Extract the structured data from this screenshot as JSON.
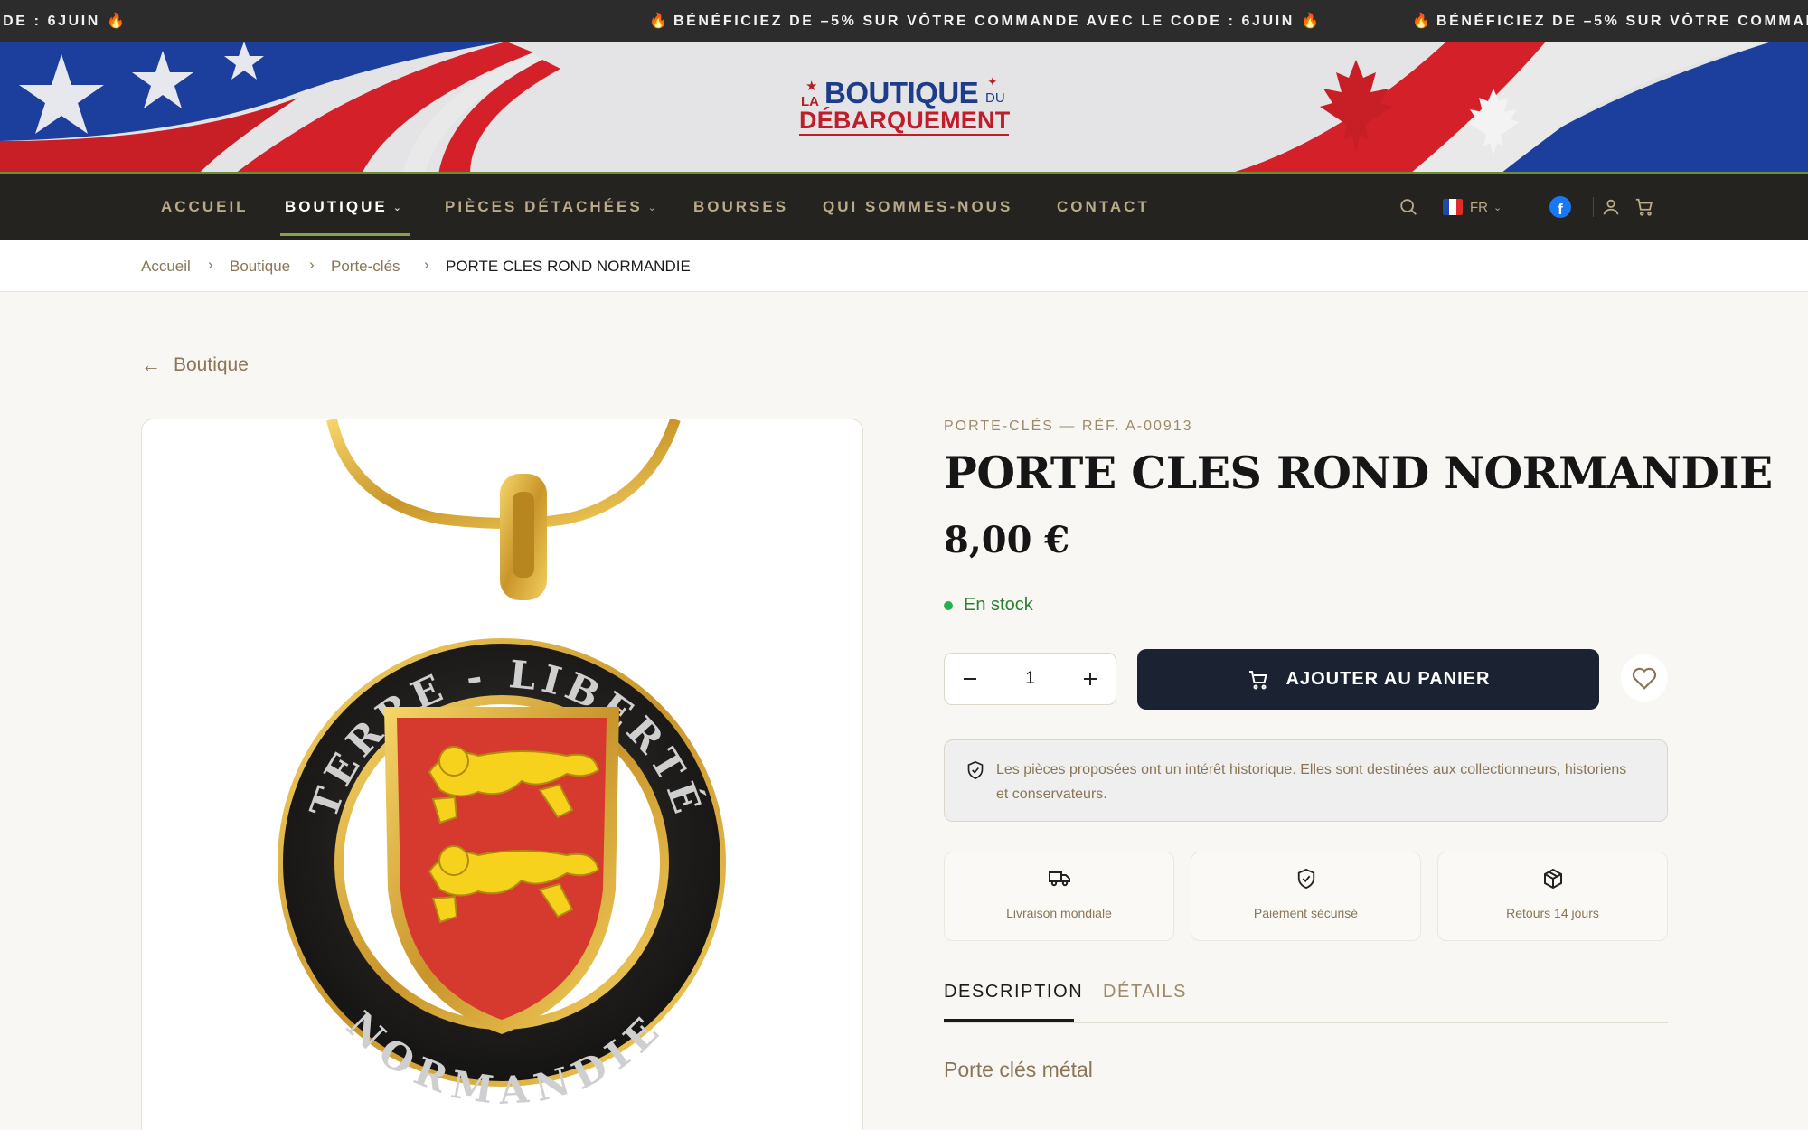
{
  "promo": {
    "message": "BÉNÉFICIEZ DE –5% SUR VÔTRE COMMANDE AVEC LE CODE : 6JUIN",
    "flame": "🔥"
  },
  "logo": {
    "la": "LA",
    "boutique": "BOUTIQUE",
    "du": "DU",
    "debarquement": "DÉBARQUEMENT"
  },
  "nav": {
    "items": [
      {
        "label": "ACCUEIL"
      },
      {
        "label": "BOUTIQUE",
        "active": true,
        "dropdown": true
      },
      {
        "label": "PIÈCES DÉTACHÉES",
        "dropdown": true
      },
      {
        "label": "BOURSES"
      },
      {
        "label": "QUI SOMMES-NOUS"
      },
      {
        "label": "CONTACT"
      }
    ],
    "language": "FR",
    "icons": [
      "search-icon",
      "flag-fr-icon",
      "facebook-icon",
      "account-icon",
      "cart-icon"
    ]
  },
  "breadcrumb": {
    "items": [
      "Accueil",
      "Boutique",
      "Porte-clés"
    ],
    "current": "PORTE CLES ROND NORMANDIE"
  },
  "back": {
    "label": "Boutique"
  },
  "product": {
    "category_ref": "PORTE-CLÉS — RÉF. A-00913",
    "title": "PORTE CLES ROND NORMANDIE",
    "price": "8,00 €",
    "stock": "En stock",
    "quantity": "1",
    "add_to_cart": "AJOUTER AU PANIER",
    "notice": "Les pièces proposées ont un intérêt historique. Elles sont destinées aux collectionneurs, historiens et conservateurs.",
    "features": [
      {
        "label": "Livraison mondiale",
        "icon": "truck-icon"
      },
      {
        "label": "Paiement sécurisé",
        "icon": "shield-check-icon"
      },
      {
        "label": "Retours 14 jours",
        "icon": "package-icon"
      }
    ],
    "tabs": [
      {
        "label": "DESCRIPTION",
        "active": true
      },
      {
        "label": "DÉTAILS"
      }
    ],
    "description": "Porte clés métal",
    "image_text": {
      "top": "TERRE - LIBERTÉ",
      "bottom": "NORMANDIE"
    }
  },
  "colors": {
    "nav_bg": "#24231f",
    "accent_green": "#87a24c",
    "button_dark": "#1b2232",
    "stock_green": "#22b14c",
    "muted_brown": "#8a7656"
  }
}
